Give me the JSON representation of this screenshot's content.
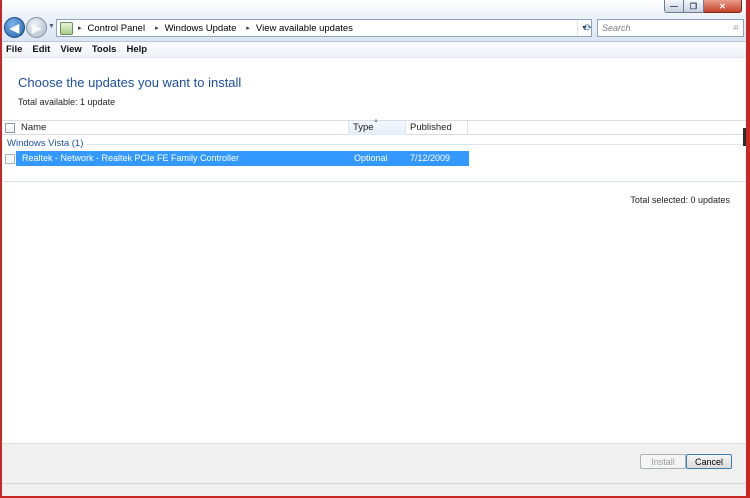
{
  "window": {
    "caption": {
      "minimize": "—",
      "maximize": "❐",
      "close": "✕"
    }
  },
  "nav": {
    "back_icon": "◀",
    "forward_icon": "▶",
    "dropdown_icon": "▼",
    "breadcrumbs": [
      "Control Panel",
      "Windows Update",
      "View available updates"
    ],
    "crumb_separator": "▸",
    "refresh_icon": "⟳",
    "search_placeholder": "Search",
    "search_icon": "⌕"
  },
  "menubar": {
    "items": [
      "File",
      "Edit",
      "View",
      "Tools",
      "Help"
    ]
  },
  "main": {
    "heading": "Choose the updates you want to install",
    "total_available": "Total available: 1 update",
    "columns": {
      "name": "Name",
      "type": "Type",
      "published": "Published"
    },
    "sort_icon": "▲",
    "group": {
      "label": "Windows Vista (1)"
    },
    "updates": [
      {
        "name": "Realtek - Network - Realtek PCIe FE Family Controller",
        "type": "Optional",
        "published": "7/12/2009",
        "selected_highlight": true,
        "checked": false
      }
    ],
    "total_selected": "Total selected: 0 updates"
  },
  "footer": {
    "install_label": "Install",
    "cancel_label": "Cancel"
  },
  "colors": {
    "accent": "#1e4fa0",
    "selection": "#3399ff",
    "frame": "#c62828"
  }
}
